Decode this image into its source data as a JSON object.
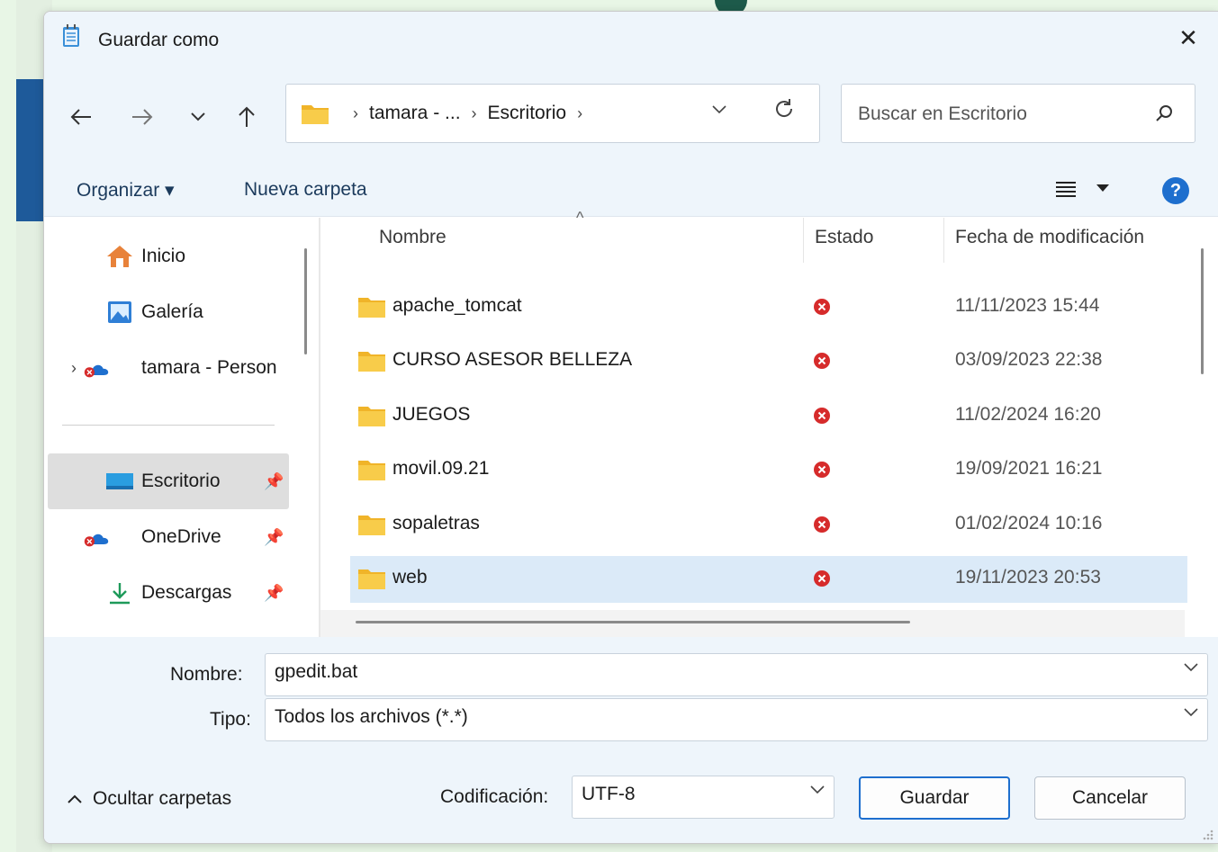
{
  "window": {
    "title": "Guardar como",
    "close_label": "✕"
  },
  "nav": {
    "back_icon": "arrow-left-icon",
    "forward_icon": "arrow-right-icon",
    "recent_icon": "chevron-down-icon",
    "up_icon": "arrow-up-icon"
  },
  "address": {
    "crumbs": [
      "tamara - ...",
      "Escritorio"
    ]
  },
  "search": {
    "placeholder": "Buscar en Escritorio"
  },
  "toolbar": {
    "organize_label": "Organizar ▾",
    "new_folder_label": "Nueva carpeta",
    "help_label": "?"
  },
  "sidebar": {
    "items": [
      {
        "label": "Inicio",
        "icon": "home-icon"
      },
      {
        "label": "Galería",
        "icon": "gallery-icon"
      },
      {
        "label": "tamara - Person",
        "icon": "onedrive-icon"
      },
      {
        "label": "Escritorio",
        "icon": "desktop-icon"
      },
      {
        "label": "OneDrive",
        "icon": "onedrive-icon"
      },
      {
        "label": "Descargas",
        "icon": "download-icon"
      }
    ]
  },
  "filelist": {
    "columns": {
      "name": "Nombre",
      "status": "Estado",
      "modified": "Fecha de modificación"
    },
    "rows": [
      {
        "name": "apache_tomcat",
        "modified": "11/11/2023 15:44"
      },
      {
        "name": "CURSO ASESOR BELLEZA",
        "modified": "03/09/2023 22:38"
      },
      {
        "name": "JUEGOS",
        "modified": "11/02/2024 16:20"
      },
      {
        "name": "movil.09.21",
        "modified": "19/09/2021 16:21"
      },
      {
        "name": "sopaletras",
        "modified": "01/02/2024 10:16"
      },
      {
        "name": "web",
        "modified": "19/11/2023 20:53"
      }
    ]
  },
  "form": {
    "name_label": "Nombre:",
    "name_value": "gpedit.bat",
    "type_label": "Tipo:",
    "type_value": "Todos los archivos  (*.*)",
    "encoding_label": "Codificación:",
    "encoding_value": "UTF-8"
  },
  "footer": {
    "toggle_folders_label": "Ocultar carpetas",
    "save_label": "Guardar",
    "cancel_label": "Cancelar"
  },
  "colors": {
    "accent": "#1e6fce",
    "folder": "#f5c542",
    "error": "#d62b2b",
    "selected_row": "#dbeaf8"
  }
}
